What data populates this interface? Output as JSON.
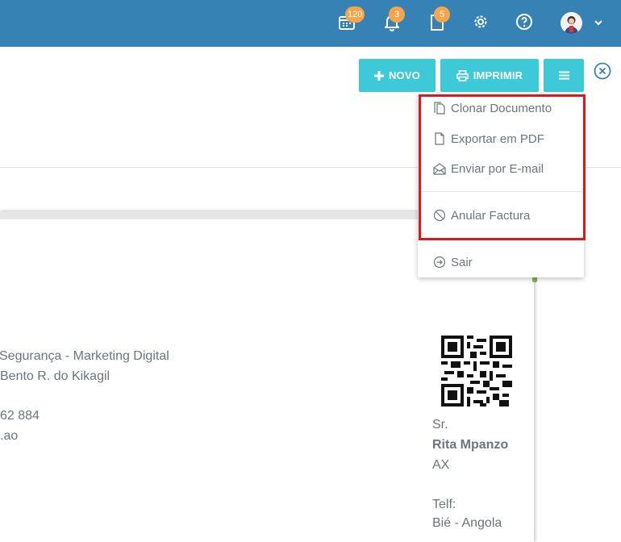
{
  "header": {
    "calendar_badge": "120",
    "notifications_badge": "3",
    "documents_badge": "5",
    "colors": {
      "bar": "#3782b4",
      "badge": "#f7a54b"
    }
  },
  "toolbar": {
    "novo_label": "NOVO",
    "imprimir_label": "IMPRIMIR",
    "button_color": "#3dc9d8"
  },
  "menu": {
    "items": [
      {
        "label": "Clonar Documento",
        "icon": "copy-icon"
      },
      {
        "label": "Exportar em PDF",
        "icon": "file-icon"
      },
      {
        "label": "Enviar por E-mail",
        "icon": "envelope-open-icon"
      },
      {
        "label": "Anular Factura",
        "icon": "ban-icon"
      },
      {
        "label": "Sair",
        "icon": "arrow-circle-right-icon"
      }
    ],
    "highlight_color": "#e0161d"
  },
  "document": {
    "company_line1": "Segurança - Marketing Digital",
    "company_line2": "Bento R. do Kikagil",
    "company_phone": "62 884",
    "company_email": ".ao",
    "client_title": "Sr.",
    "client_name": "Rita Mpanzo",
    "client_code": "AX",
    "client_phone_label": "Telf:",
    "client_address": "Bié - Angola"
  }
}
